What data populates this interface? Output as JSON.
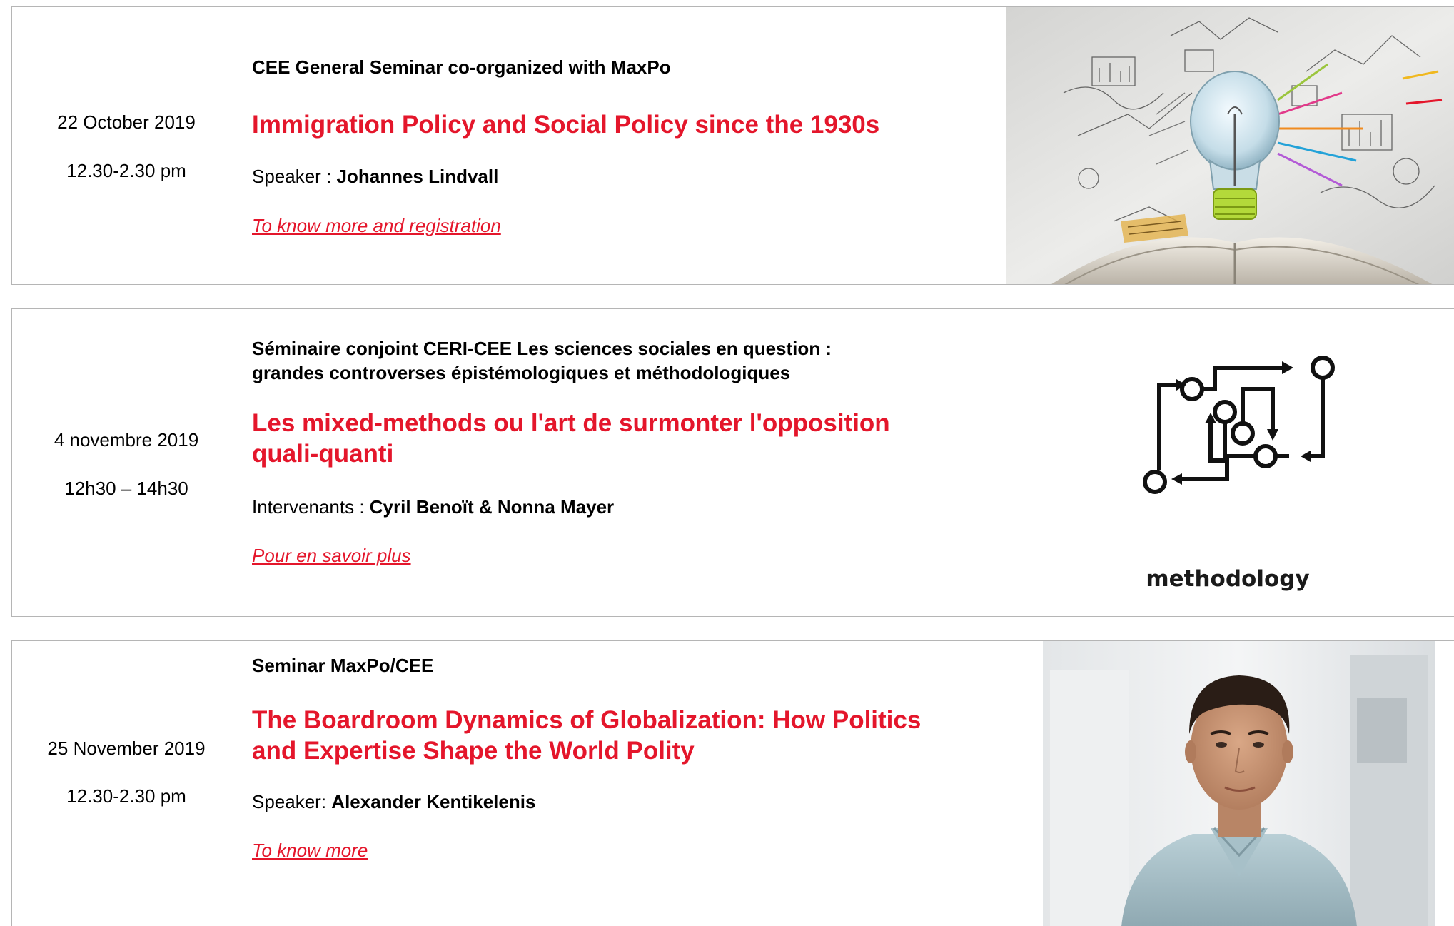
{
  "events": [
    {
      "date": "22 October 2019",
      "time": "12.30-2.30 pm",
      "series": "CEE General Seminar co-organized with MaxPo",
      "title": "Immigration Policy and Social Policy since the 1930s",
      "speaker_label": "Speaker : ",
      "speaker_name": "Johannes Lindvall",
      "link_text": "To know more and registration",
      "image_icon": "lightbulb-book-illustration"
    },
    {
      "date": "4 novembre 2019",
      "time": "12h30 – 14h30",
      "series_line1": "Séminaire conjoint CERI-CEE Les sciences sociales en question :",
      "series_line2": "grandes controverses épistémologiques et méthodologiques",
      "title_line1": "Les mixed-methods ou l'art de surmonter l'opposition",
      "title_line2": "quali-quanti",
      "speaker_label": "Intervenants : ",
      "speaker_name": "Cyril Benoït & Nonna Mayer",
      "link_text": "Pour en savoir plus",
      "image_icon": "methodology-icon",
      "image_caption": "methodology"
    },
    {
      "date": "25 November 2019",
      "time": "12.30-2.30 pm",
      "series": "Seminar MaxPo/CEE",
      "title_line1": "The Boardroom Dynamics of Globalization: How Politics",
      "title_line2": "and Expertise Shape the World Polity",
      "speaker_label": "Speaker: ",
      "speaker_name": "Alexander Kentikelenis",
      "link_text": "To know more",
      "image_icon": "speaker-portrait"
    }
  ],
  "colors": {
    "accent": "#e4162b",
    "border": "#b5b5b5",
    "text": "#000000"
  }
}
